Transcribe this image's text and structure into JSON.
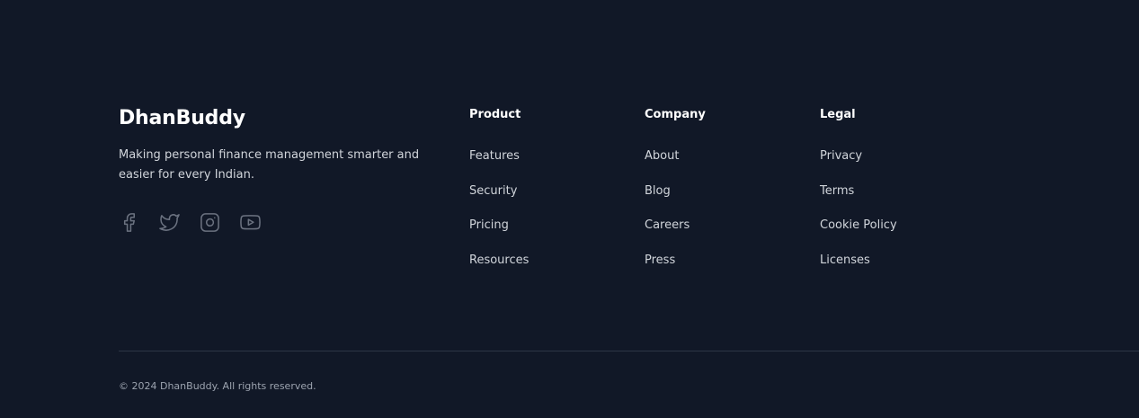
{
  "brand": {
    "name": "DhanBuddy",
    "tagline": "Making personal finance management smarter and easier for every Indian."
  },
  "social": [
    {
      "icon": "facebook-icon"
    },
    {
      "icon": "twitter-icon"
    },
    {
      "icon": "instagram-icon"
    },
    {
      "icon": "youtube-icon"
    }
  ],
  "columns": {
    "product": {
      "title": "Product",
      "links": [
        "Features",
        "Security",
        "Pricing",
        "Resources"
      ]
    },
    "company": {
      "title": "Company",
      "links": [
        "About",
        "Blog",
        "Careers",
        "Press"
      ]
    },
    "legal": {
      "title": "Legal",
      "links": [
        "Privacy",
        "Terms",
        "Cookie Policy",
        "Licenses"
      ]
    }
  },
  "copyright": "© 2024 DhanBuddy. All rights reserved.",
  "colors": {
    "background": "#111827",
    "heading": "#ffffff",
    "link": "#d1d5db",
    "icon": "#6b7280",
    "muted": "#9ca3af"
  }
}
